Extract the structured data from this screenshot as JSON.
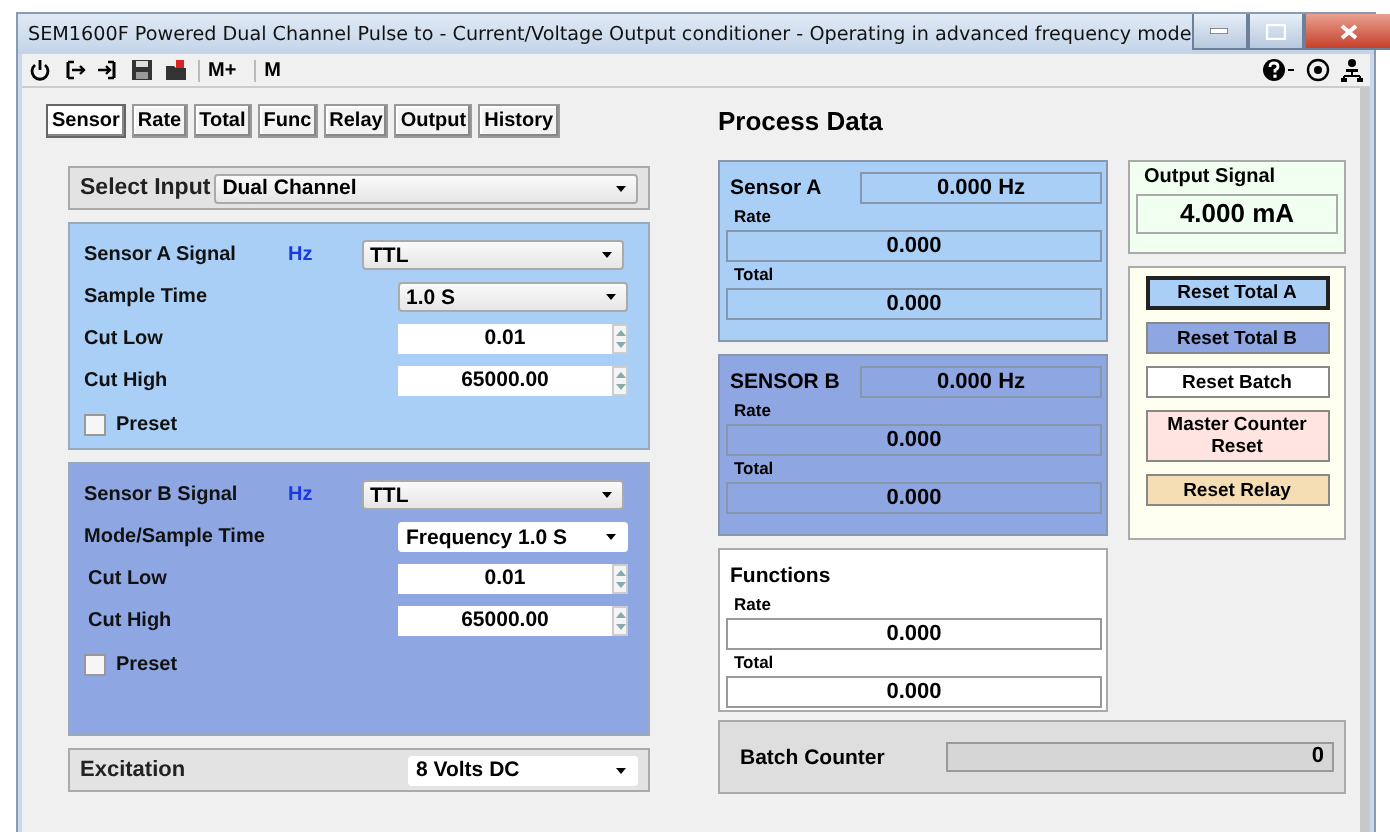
{
  "window": {
    "title": "SEM1600F  Powered  Dual Channel Pulse to - Current/Voltage Output conditioner - Operating in advanced frequency mode"
  },
  "toolbar": {
    "text_buttons": [
      "M+",
      "M"
    ]
  },
  "tabs": [
    {
      "label": "Sensor",
      "selected": true
    },
    {
      "label": "Rate",
      "selected": false
    },
    {
      "label": "Total",
      "selected": false
    },
    {
      "label": "Func",
      "selected": false
    },
    {
      "label": "Relay",
      "selected": false
    },
    {
      "label": "Output",
      "selected": false
    },
    {
      "label": "History",
      "selected": false
    }
  ],
  "heading": "Process Data",
  "select_input": {
    "label": "Select Input",
    "value": "Dual Channel"
  },
  "sensor_panels": [
    {
      "signal_label": "Sensor A Signal",
      "unit": "Hz",
      "signal": "TTL",
      "sample_label": "Sample Time",
      "sample": "1.0  S",
      "cut_low_label": "Cut Low",
      "cut_low": "0.01",
      "cut_high_label": "Cut High",
      "cut_high": "65000.00",
      "preset_label": "Preset",
      "preset_checked": false,
      "color": "#a9cff7"
    },
    {
      "signal_label": "Sensor B Signal",
      "unit": "Hz",
      "signal": "TTL",
      "sample_label": "Mode/Sample Time",
      "sample": "Frequency 1.0  S",
      "cut_low_label": "Cut Low",
      "cut_low": "0.01",
      "cut_high_label": "Cut High",
      "cut_high": "65000.00",
      "preset_label": "Preset",
      "preset_checked": false,
      "color": "#8ea7e2"
    }
  ],
  "excitation": {
    "label": "Excitation",
    "value": "8  Volts DC"
  },
  "process_boxes": [
    {
      "title": "Sensor A",
      "reading": "0.000  Hz",
      "rate_label": "Rate",
      "rate": "0.000",
      "total_label": "Total",
      "total": "0.000",
      "color": "#a9cff7"
    },
    {
      "title": "SENSOR B",
      "reading": "0.000  Hz",
      "rate_label": "Rate",
      "rate": "0.000",
      "total_label": "Total",
      "total": "0.000",
      "color": "#8ea7e2"
    },
    {
      "title": "Functions",
      "rate_label": "Rate",
      "rate": "0.000",
      "total_label": "Total",
      "total": "0.000",
      "color": "#ffffff"
    }
  ],
  "output_signal": {
    "title": "Output Signal",
    "value": "4.000  mA"
  },
  "reset_buttons": [
    {
      "label": "Reset Total A",
      "color": "#a9cff7"
    },
    {
      "label": "Reset Total B",
      "color": "#8ea7e2"
    },
    {
      "label": "Reset Batch",
      "color": "#ffffff"
    },
    {
      "label": "Master Counter Reset",
      "color": "#ffe4e1"
    },
    {
      "label": "Reset  Relay",
      "color": "#f5deb3"
    }
  ],
  "batch_counter": {
    "label": "Batch Counter",
    "value": "0"
  }
}
